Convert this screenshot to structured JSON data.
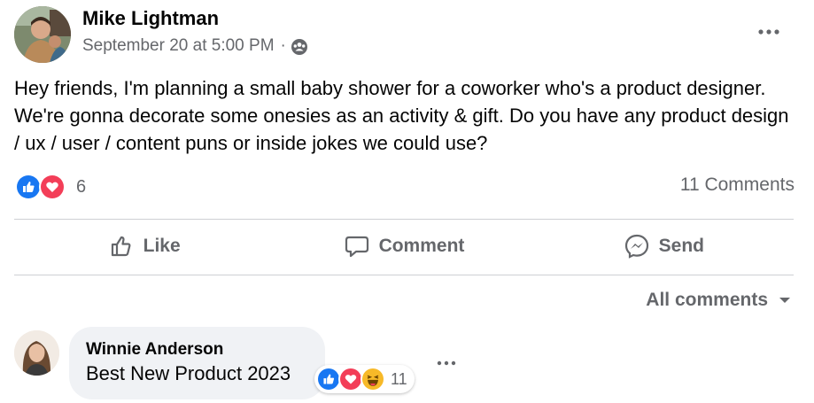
{
  "post": {
    "author": "Mike Lightman",
    "timestamp": "September 20 at 5:00 PM",
    "separator": "·",
    "audience_icon": "friends-group-icon",
    "more_icon": "more-horizontal-icon",
    "text": "Hey friends, I'm planning a small baby shower for a coworker who's a product designer. We're gonna decorate some onesies as an activity & gift. Do you have any product design / ux / user / content puns or inside jokes we could use?",
    "reactions": {
      "icons": [
        "like-reaction-icon",
        "love-reaction-icon"
      ],
      "count": "6"
    },
    "comments_count": "11 Comments"
  },
  "actions": {
    "like": {
      "label": "Like",
      "icon": "thumbs-up-icon"
    },
    "comment": {
      "label": "Comment",
      "icon": "comment-bubble-icon"
    },
    "send": {
      "label": "Send",
      "icon": "messenger-icon"
    }
  },
  "comments_filter": {
    "label": "All comments",
    "icon": "caret-down-icon"
  },
  "comments": [
    {
      "author": "Winnie Anderson",
      "text": "Best New Product 2023",
      "reactions": {
        "icons": [
          "like-reaction-icon",
          "love-reaction-icon",
          "haha-reaction-icon"
        ],
        "count": "11"
      },
      "more_icon": "more-horizontal-icon"
    }
  ],
  "colors": {
    "text_primary": "#050505",
    "text_secondary": "#65676b",
    "divider": "#ced0d4",
    "bubble_bg": "#f0f2f5",
    "like_blue": "#1877f2",
    "love_red": "#f33e58",
    "haha_yellow": "#f7b928"
  }
}
